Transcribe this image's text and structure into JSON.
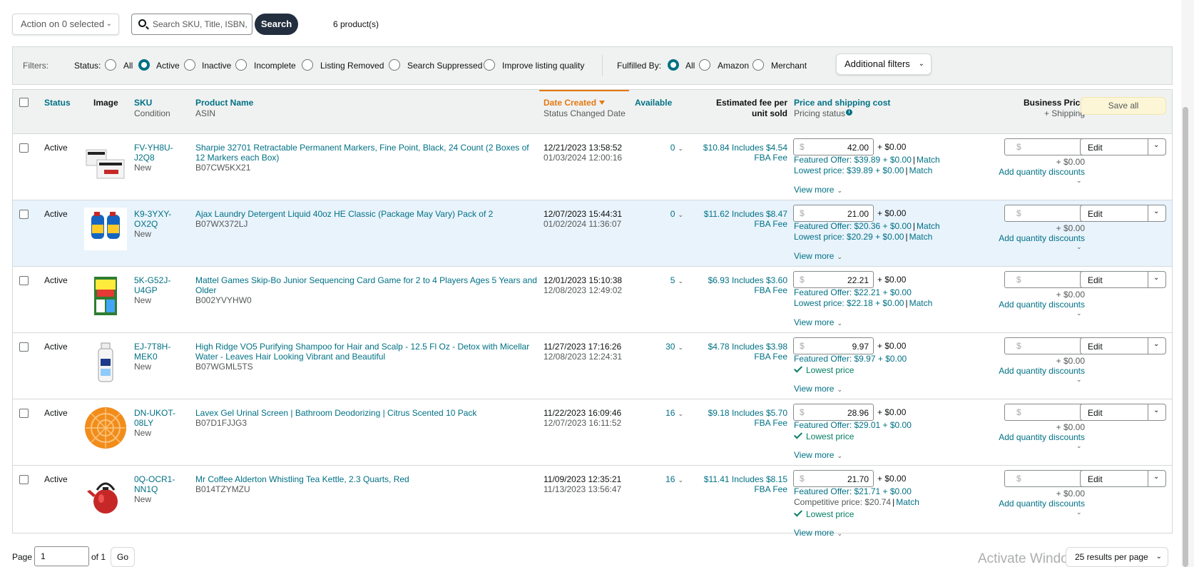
{
  "toolbar": {
    "action_label": "Action on 0 selected",
    "search_placeholder": "Search SKU, Title, ISBN,",
    "search_button": "Search",
    "product_count": "6 product(s)"
  },
  "filters": {
    "label": "Filters:",
    "status_label": "Status:",
    "status_options": [
      "All",
      "Active",
      "Inactive",
      "Incomplete",
      "Listing Removed",
      "Search Suppressed",
      "Improve listing quality"
    ],
    "status_selected": "Active",
    "fulfilled_label": "Fulfilled By:",
    "fulfilled_options": [
      "All",
      "Amazon",
      "Merchant"
    ],
    "fulfilled_selected": "All",
    "additional_button": "Additional filters"
  },
  "table": {
    "headers": {
      "status": "Status",
      "image": "Image",
      "sku": "SKU",
      "sku_sub": "Condition",
      "product": "Product Name",
      "product_sub": "ASIN",
      "date": "Date Created",
      "date_sub": "Status Changed Date",
      "available": "Available",
      "fee": "Estimated fee per",
      "fee2": "unit sold",
      "price": "Price and shipping cost",
      "price_sub": "Pricing status",
      "business": "Business Price",
      "business_sub": "+ Shipping",
      "save_all": "Save all"
    },
    "rows": [
      {
        "status": "Active",
        "sku1": "FV-YH8U-",
        "sku2": "J2Q8",
        "condition": "New",
        "name1": "Sharpie 32701 Retractable Permanent Markers, Fine Point, Black, 24 Count (2 Boxes of",
        "name2": "12 Markers each Box)",
        "asin": "B07CW5KX21",
        "created": "12/21/2023 13:58:52",
        "changed": "01/03/2024 12:00:16",
        "available": "0",
        "fee1": "$10.84 Includes $4.54",
        "fee2": "FBA Fee",
        "price": "42.00",
        "shipping": "+ $0.00",
        "featured": "Featured Offer: $39.89 + $0.00",
        "featured_match": "Match",
        "lowest": "Lowest price: $39.89 + $0.00",
        "lowest_match": "Match",
        "view_more": "View more",
        "bp_ship": "+ $0.00",
        "qd": "Add quantity discounts",
        "edit": "Edit"
      },
      {
        "status": "Active",
        "sku1": "K9-3YXY-",
        "sku2": "OX2Q",
        "condition": "New",
        "name1": "Ajax Laundry Detergent Liquid 40oz HE Classic (Package May Vary) Pack of 2",
        "name2": "",
        "asin": "B07WX372LJ",
        "created": "12/07/2023 15:44:31",
        "changed": "01/02/2024 11:36:07",
        "available": "0",
        "fee1": "$11.62 Includes $8.47",
        "fee2": "FBA Fee",
        "price": "21.00",
        "shipping": "+ $0.00",
        "featured": "Featured Offer: $20.36 + $0.00",
        "featured_match": "Match",
        "lowest": "Lowest price: $20.29 + $0.00",
        "lowest_match": "Match",
        "view_more": "View more",
        "bp_ship": "+ $0.00",
        "qd": "Add quantity discounts",
        "edit": "Edit"
      },
      {
        "status": "Active",
        "sku1": "5K-G52J-",
        "sku2": "U4GP",
        "condition": "New",
        "name1": "Mattel Games Skip-Bo Junior Sequencing Card Game for 2 to 4 Players Ages 5 Years and",
        "name2": "Older",
        "asin": "B002YVYHW0",
        "created": "12/01/2023 15:10:38",
        "changed": "12/08/2023 12:49:02",
        "available": "5",
        "fee1": "$6.93 Includes $3.60",
        "fee2": "FBA Fee",
        "price": "22.21",
        "shipping": "+ $0.00",
        "featured": "Featured Offer: $22.21 + $0.00",
        "featured_match": "",
        "lowest": "Lowest price: $22.18 + $0.00",
        "lowest_match": "Match",
        "view_more": "View more",
        "bp_ship": "+ $0.00",
        "qd": "Add quantity discounts",
        "edit": "Edit"
      },
      {
        "status": "Active",
        "sku1": "EJ-7T8H-",
        "sku2": "MEK0",
        "condition": "New",
        "name1": "High Ridge VO5 Purifying Shampoo for Hair and Scalp - 12.5 Fl Oz - Detox with Micellar",
        "name2": "Water - Leaves Hair Looking Vibrant and Beautiful",
        "asin": "B07WGML5TS",
        "created": "11/27/2023 17:16:26",
        "changed": "12/08/2023 12:24:31",
        "available": "30",
        "fee1": "$4.78 Includes $3.98",
        "fee2": "FBA Fee",
        "price": "9.97",
        "shipping": "+ $0.00",
        "featured": "Featured Offer: $9.97 + $0.00",
        "featured_match": "",
        "lowest_ok": "Lowest price",
        "view_more": "View more",
        "bp_ship": "+ $0.00",
        "qd": "Add quantity discounts",
        "edit": "Edit"
      },
      {
        "status": "Active",
        "sku1": "DN-UKOT-",
        "sku2": "08LY",
        "condition": "New",
        "name1": "Lavex Gel Urinal Screen | Bathroom Deodorizing | Citrus Scented 10 Pack",
        "name2": "",
        "asin": "B07D1FJJG3",
        "created": "11/22/2023 16:09:46",
        "changed": "12/07/2023 16:11:52",
        "available": "16",
        "fee1": "$9.18 Includes $5.70",
        "fee2": "FBA Fee",
        "price": "28.96",
        "shipping": "+ $0.00",
        "featured": "Featured Offer: $29.01 + $0.00",
        "featured_match": "",
        "lowest_ok": "Lowest price",
        "view_more": "View more",
        "bp_ship": "+ $0.00",
        "qd": "Add quantity discounts",
        "edit": "Edit"
      },
      {
        "status": "Active",
        "sku1": "0Q-OCR1-",
        "sku2": "NN1Q",
        "condition": "New",
        "name1": "Mr Coffee Alderton Whistling Tea Kettle, 2.3 Quarts, Red",
        "name2": "",
        "asin": "B014TZYMZU",
        "created": "11/09/2023 12:35:21",
        "changed": "11/13/2023 13:56:47",
        "available": "16",
        "fee1": "$11.41 Includes $8.15",
        "fee2": "FBA Fee",
        "price": "21.70",
        "shipping": "+ $0.00",
        "featured": "Featured Offer: $21.71 + $0.00",
        "featured_match": "",
        "competitive": "Competitive price: $20.74",
        "competitive_match": "Match",
        "lowest_ok": "Lowest price",
        "view_more": "View more",
        "bp_ship": "+ $0.00",
        "qd": "Add quantity discounts",
        "edit": "Edit"
      }
    ]
  },
  "footer": {
    "page_label": "Page",
    "page_value": "1",
    "of_label": "of 1",
    "go": "Go",
    "results_per_page": "25 results per page"
  },
  "watermark": "Activate Windows",
  "currency_symbol": "$"
}
